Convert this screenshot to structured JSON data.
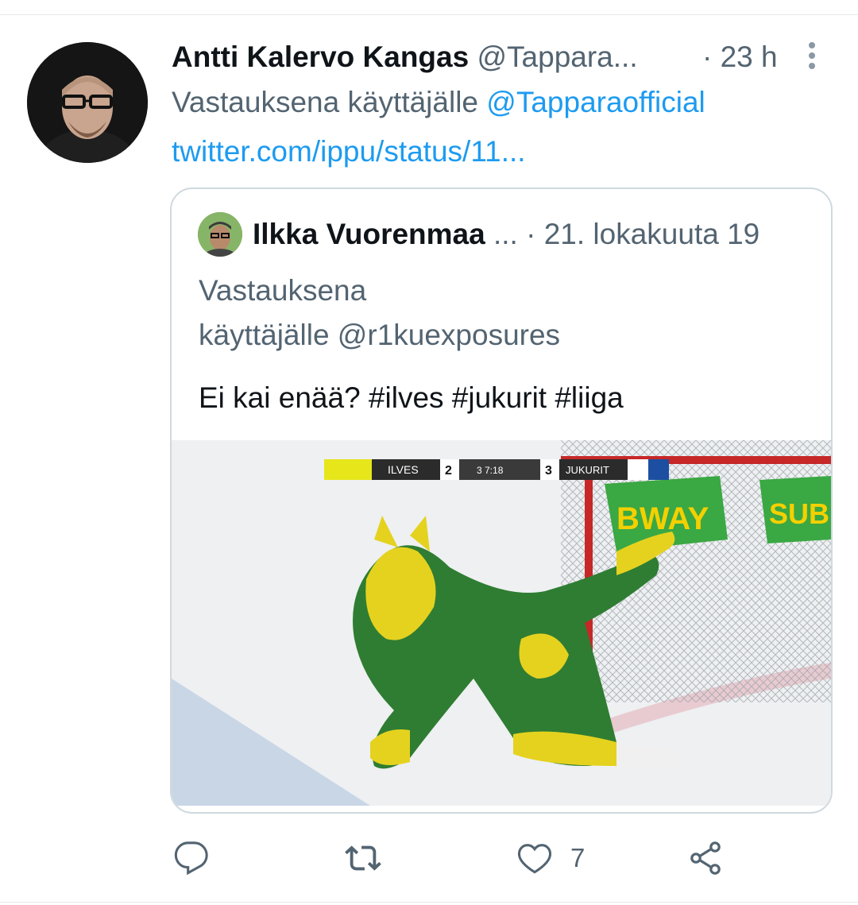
{
  "tweet": {
    "author_name": "Antti Kalervo Kangas",
    "author_handle": "@Tappara...",
    "separator_time": "· 23 h",
    "reply_prefix": "Vastauksena käyttäjälle ",
    "reply_handle": "@Tapparaofficial",
    "link_text": "twitter.com/ippu/status/11...",
    "avatar_icon": "user-avatar-photo",
    "more_icon": "more-vertical-icon"
  },
  "quoted_tweet": {
    "author_name": "Ilkka Vuorenmaa",
    "ellipsis_date": " ... · 21. lokakuuta 19",
    "reply_line1": "Vastauksena",
    "reply_line2": "käyttäjälle @r1kuexposures",
    "text": "Ei kai enää? #ilves #jukurit #liiga",
    "media": {
      "scoreboard": {
        "home": "ILVES",
        "home_score": "2",
        "period_time": "3  7:18",
        "away_score": "3",
        "away": "JUKURIT"
      },
      "banner_text_1": "BWAY",
      "banner_text_2": "SUB"
    }
  },
  "actions": {
    "reply_icon": "reply-icon",
    "retweet_icon": "retweet-icon",
    "like_icon": "heart-icon",
    "like_count": "7",
    "share_icon": "share-icon"
  },
  "colors": {
    "link": "#1d9bf0",
    "secondary_text": "#536471",
    "primary_text": "#0f1419",
    "border": "#cfd9de"
  }
}
